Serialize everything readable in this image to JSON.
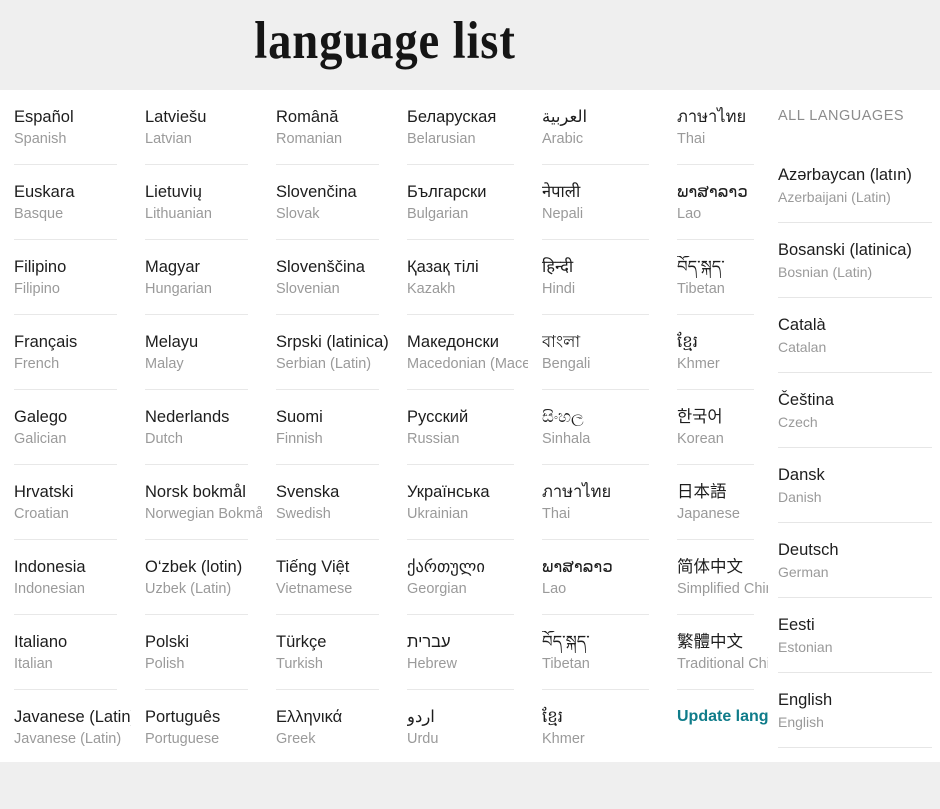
{
  "header": {
    "title": "language  list"
  },
  "columns": [
    {
      "id": "col-1",
      "items": [
        {
          "native": "Español",
          "english": "Spanish"
        },
        {
          "native": "Euskara",
          "english": "Basque"
        },
        {
          "native": "Filipino",
          "english": "Filipino"
        },
        {
          "native": "Français",
          "english": "French"
        },
        {
          "native": "Galego",
          "english": "Galician"
        },
        {
          "native": "Hrvatski",
          "english": "Croatian"
        },
        {
          "native": "Indonesia",
          "english": "Indonesian"
        },
        {
          "native": "Italiano",
          "english": "Italian"
        },
        {
          "native": "Javanese (Latin)",
          "english": "Javanese (Latin)"
        }
      ]
    },
    {
      "id": "col-2",
      "items": [
        {
          "native": "Latviešu",
          "english": "Latvian"
        },
        {
          "native": "Lietuvių",
          "english": "Lithuanian"
        },
        {
          "native": "Magyar",
          "english": "Hungarian"
        },
        {
          "native": "Melayu",
          "english": "Malay"
        },
        {
          "native": "Nederlands",
          "english": "Dutch"
        },
        {
          "native": "Norsk bokmål",
          "english": "Norwegian Bokmål"
        },
        {
          "native": "O‘zbek (lotin)",
          "english": "Uzbek (Latin)"
        },
        {
          "native": "Polski",
          "english": "Polish"
        },
        {
          "native": "Português",
          "english": "Portuguese"
        }
      ]
    },
    {
      "id": "col-3",
      "items": [
        {
          "native": "Română",
          "english": "Romanian"
        },
        {
          "native": "Slovenčina",
          "english": "Slovak"
        },
        {
          "native": "Slovenščina",
          "english": "Slovenian"
        },
        {
          "native": "Srpski (latinica)",
          "english": "Serbian (Latin)"
        },
        {
          "native": "Suomi",
          "english": "Finnish"
        },
        {
          "native": "Svenska",
          "english": "Swedish"
        },
        {
          "native": "Tiếng Việt",
          "english": "Vietnamese"
        },
        {
          "native": "Türkçe",
          "english": "Turkish"
        },
        {
          "native": "Ελληνικά",
          "english": "Greek"
        }
      ]
    },
    {
      "id": "col-4",
      "items": [
        {
          "native": "Беларуская",
          "english": "Belarusian"
        },
        {
          "native": "Български",
          "english": "Bulgarian"
        },
        {
          "native": "Қазақ тілі",
          "english": "Kazakh"
        },
        {
          "native": "Македонски",
          "english": "Macedonian (Macedonia)"
        },
        {
          "native": "Русский",
          "english": "Russian"
        },
        {
          "native": "Українська",
          "english": "Ukrainian"
        },
        {
          "native": "ქართული",
          "english": "Georgian"
        },
        {
          "native": "עברית",
          "english": "Hebrew"
        },
        {
          "native": "اردو",
          "english": "Urdu"
        }
      ]
    },
    {
      "id": "col-5",
      "items": [
        {
          "native": "العربية",
          "english": "Arabic"
        },
        {
          "native": "नेपाली",
          "english": "Nepali"
        },
        {
          "native": "हिन्दी",
          "english": "Hindi"
        },
        {
          "native": "বাংলা",
          "english": "Bengali"
        },
        {
          "native": "සිංහල",
          "english": "Sinhala"
        },
        {
          "native": "ภาษาไทย",
          "english": "Thai"
        },
        {
          "native": "ພາສາລາວ",
          "english": "Lao"
        },
        {
          "native": "བོད་སྐད་",
          "english": "Tibetan"
        },
        {
          "native": "ខ្មែរ",
          "english": "Khmer"
        }
      ]
    },
    {
      "id": "col-6",
      "items": [
        {
          "native": "ภาษาไทย",
          "english": "Thai"
        },
        {
          "native": "ພາສາລາວ",
          "english": "Lao"
        },
        {
          "native": "བོད་སྐད་",
          "english": "Tibetan"
        },
        {
          "native": "ខ្មែរ",
          "english": "Khmer"
        },
        {
          "native": "한국어",
          "english": "Korean"
        },
        {
          "native": "日本語",
          "english": "Japanese"
        },
        {
          "native": "简体中文",
          "english": "Simplified Chinese"
        },
        {
          "native": "繁體中文",
          "english": "Traditional Chinese"
        }
      ],
      "update_link": "Update language"
    },
    {
      "id": "col-7",
      "section_header": "ALL LANGUAGES",
      "items": [
        {
          "native": "Azərbaycan (latın)",
          "english": "Azerbaijani (Latin)"
        },
        {
          "native": "Bosanski (latinica)",
          "english": "Bosnian (Latin)"
        },
        {
          "native": "Català",
          "english": "Catalan"
        },
        {
          "native": "Čeština",
          "english": "Czech"
        },
        {
          "native": "Dansk",
          "english": "Danish"
        },
        {
          "native": "Deutsch",
          "english": "German"
        },
        {
          "native": "Eesti",
          "english": "Estonian"
        },
        {
          "native": "English",
          "english": "English"
        }
      ]
    }
  ],
  "colors": {
    "page_background": "#efefef",
    "sheet_background": "#ffffff",
    "native_text": "#1d1d1d",
    "english_text": "#9a9a9a",
    "divider": "#e8e8e8",
    "link_accent": "#0f7c8a",
    "section_header_text": "#8c8c8c"
  }
}
